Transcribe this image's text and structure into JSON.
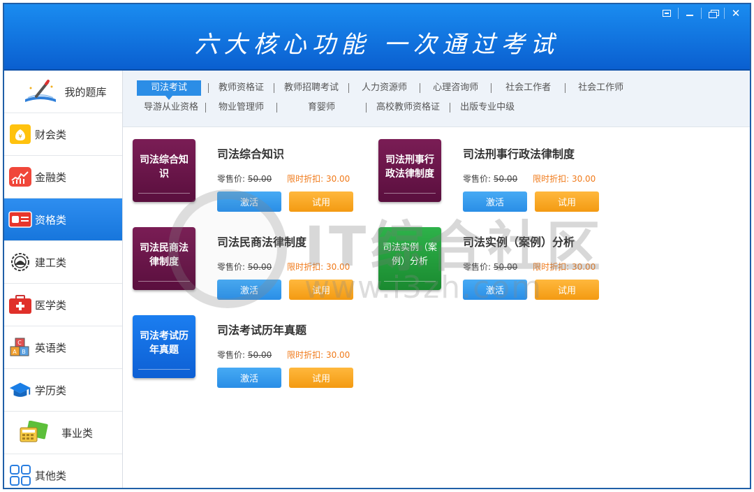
{
  "header": {
    "slogan": "六大核心功能 一次通过考试"
  },
  "window_controls": {
    "menu_icon": "dropdown-box-icon",
    "minimize_icon": "minimize-icon",
    "restore_icon": "restore-icon",
    "close_icon": "close-icon",
    "close_glyph": "✕"
  },
  "sidebar": {
    "items": [
      {
        "label": "我的题库",
        "icon": "pen-book-icon"
      },
      {
        "label": "财会类",
        "icon": "money-bag-icon"
      },
      {
        "label": "金融类",
        "icon": "finance-chart-icon"
      },
      {
        "label": "资格类",
        "icon": "id-card-icon"
      },
      {
        "label": "建工类",
        "icon": "construction-gear-icon"
      },
      {
        "label": "医学类",
        "icon": "medical-kit-icon"
      },
      {
        "label": "英语类",
        "icon": "abc-blocks-icon"
      },
      {
        "label": "学历类",
        "icon": "graduation-cap-icon"
      },
      {
        "label": "事业类",
        "icon": "calculator-icon"
      },
      {
        "label": "其他类",
        "icon": "grid-squares-icon"
      }
    ]
  },
  "tabs": {
    "row1": [
      "司法考试",
      "教师资格证",
      "教师招聘考试",
      "人力资源师",
      "心理咨询师",
      "社会工作者",
      "社会工作师"
    ],
    "row2": [
      "导游从业资格",
      "物业管理师",
      "育婴师",
      "高校教师资格证",
      "出版专业中级"
    ]
  },
  "products": [
    {
      "cover": "司法综合知识",
      "title": "司法综合知识",
      "price_label": "零售价:",
      "price": "50.00",
      "discount_label": "限时折扣:",
      "discount": "30.00",
      "activate": "激活",
      "trial": "试用",
      "color": "#6b1549"
    },
    {
      "cover": "司法刑事行政法律制度",
      "title": "司法刑事行政法律制度",
      "price_label": "零售价:",
      "price": "50.00",
      "discount_label": "限时折扣:",
      "discount": "30.00",
      "activate": "激活",
      "trial": "试用",
      "color": "#6b1549"
    },
    {
      "cover": "司法民商法律制度",
      "title": "司法民商法律制度",
      "price_label": "零售价:",
      "price": "50.00",
      "discount_label": "限时折扣:",
      "discount": "30.00",
      "activate": "激活",
      "trial": "试用",
      "color": "#6b1549"
    },
    {
      "cover": "司法实例（案例）分析",
      "title": "司法实例（案例）分析",
      "price_label": "零售价:",
      "price": "50.00",
      "discount_label": "限时折扣:",
      "discount": "30.00",
      "activate": "激活",
      "trial": "试用",
      "color": "#24a03c"
    },
    {
      "cover": "司法考试历年真题",
      "title": "司法考试历年真题",
      "price_label": "零售价:",
      "price": "50.00",
      "discount_label": "限时折扣:",
      "discount": "30.00",
      "activate": "激活",
      "trial": "试用",
      "color": "#1570e6"
    }
  ],
  "watermark": {
    "text": "IT综合社区",
    "url": "www.i3zh.com"
  }
}
